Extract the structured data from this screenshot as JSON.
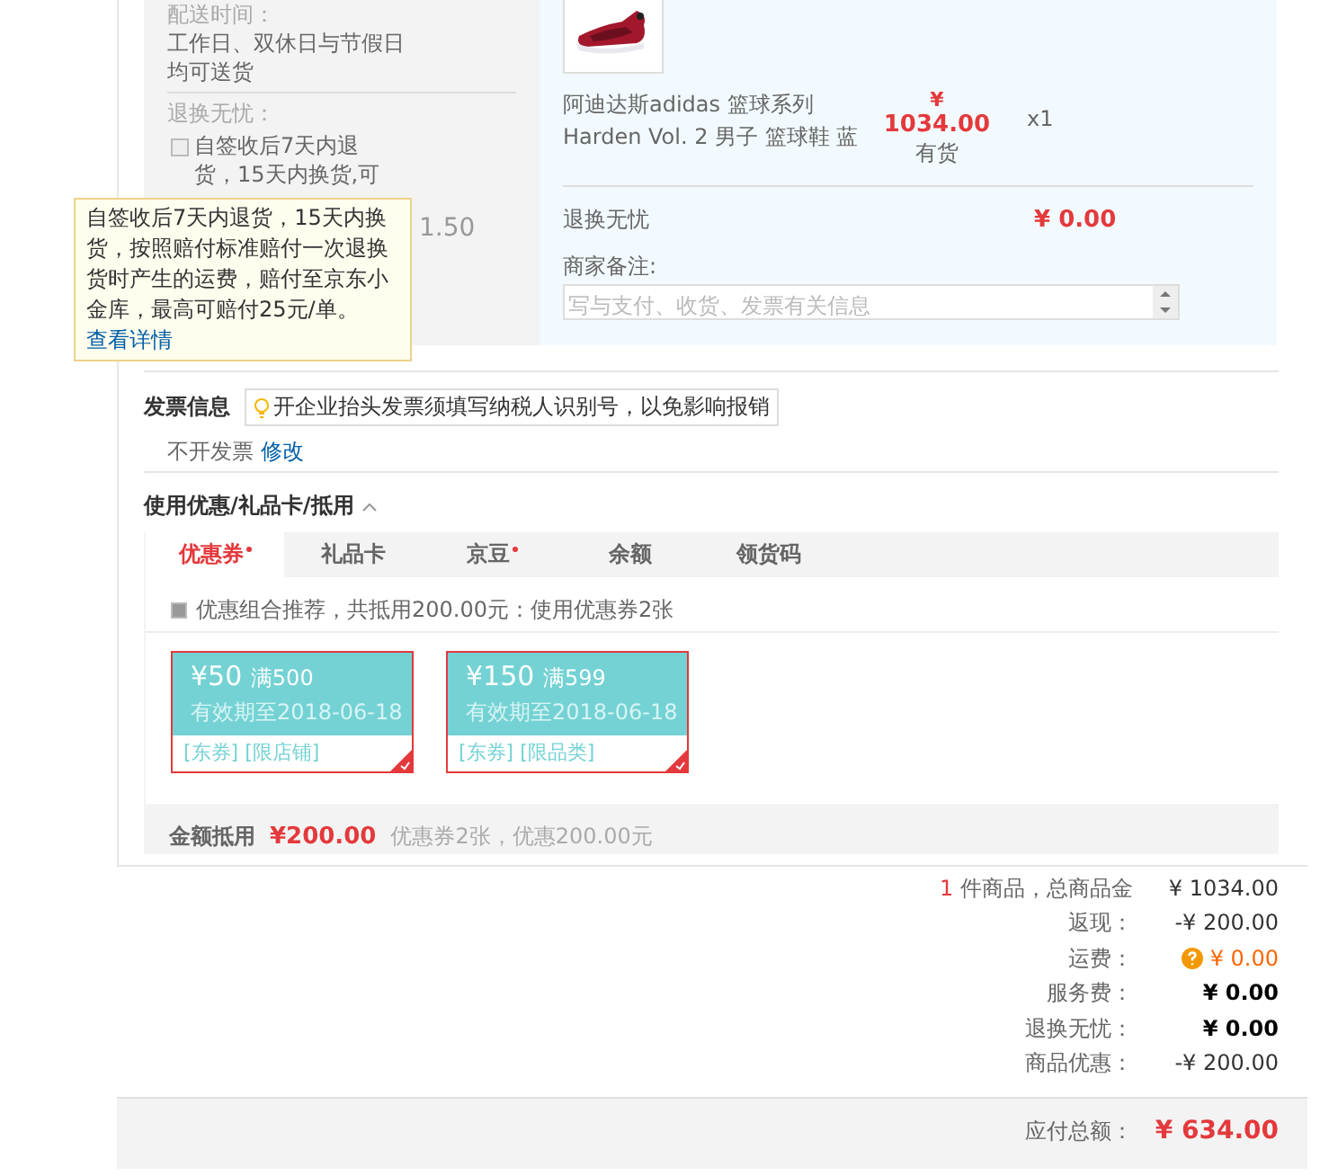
{
  "shipping": {
    "delivery_label": "配送时间：",
    "delivery_value": "工作日、双休日与节假日均可送货",
    "return_label": "退换无忧：",
    "return_option": {
      "text": "自签收后7天内退货，15天内换货,可",
      "checked": false
    },
    "return_price": "1.50",
    "tooltip": {
      "text": "自签收后7天内退货，15天内换货，按照赔付标准赔付一次退换货时产生的运费，赔付至京东小金库，最高可赔付25元/单。",
      "link": "查看详情"
    }
  },
  "product": {
    "name": "阿迪达斯adidas 篮球系列 Harden Vol. 2 男子 篮球鞋 蓝",
    "currency": "¥",
    "price": "1034.00",
    "stock": "有货",
    "quantity": "x1",
    "service_label": "退换无忧",
    "service_price": "¥ 0.00",
    "remark_label": "商家备注:",
    "remark_placeholder": "写与支付、收货、发票有关信息"
  },
  "invoice": {
    "title": "发票信息",
    "tip": "开企业抬头发票须填写纳税人识别号，以免影响报销",
    "value": "不开发票",
    "edit_link": "修改"
  },
  "discounts": {
    "title": "使用优惠/礼品卡/抵用",
    "expanded": true,
    "tabs": [
      {
        "label": "优惠券",
        "selected": true,
        "marked": true
      },
      {
        "label": "礼品卡",
        "selected": false,
        "marked": false
      },
      {
        "label": "京豆",
        "selected": false,
        "marked": true
      },
      {
        "label": "余额",
        "selected": false,
        "marked": false
      },
      {
        "label": "领货码",
        "selected": false,
        "marked": false
      }
    ],
    "recommend": {
      "text": "优惠组合推荐，共抵用200.00元：使用优惠券2张",
      "checked": true
    },
    "coupons": [
      {
        "amount": "¥50",
        "condition": "满500",
        "validity": "有效期至2018-06-18",
        "tags": "[东券] [限店铺]",
        "selected": true
      },
      {
        "amount": "¥150",
        "condition": "满599",
        "validity": "有效期至2018-06-18",
        "tags": "[东券] [限品类]",
        "selected": true
      }
    ],
    "total_label": "金额抵用",
    "total_value": "¥200.00",
    "total_note": "优惠券2张，优惠200.00元"
  },
  "summary": {
    "rows": [
      {
        "count": "1",
        "label": "件商品，总商品金",
        "value": "¥ 1034.00",
        "kind": "amount"
      },
      {
        "label": "返现：",
        "value": "-¥ 200.00",
        "kind": "amount"
      },
      {
        "label": "运费：",
        "value": "¥ 0.00",
        "kind": "fee"
      },
      {
        "label": "服务费：",
        "value": "¥ 0.00",
        "kind": "zero"
      },
      {
        "label": "退换无忧：",
        "value": "¥ 0.00",
        "kind": "zero"
      },
      {
        "label": "商品优惠：",
        "value": "-¥ 200.00",
        "kind": "amount"
      }
    ],
    "total_label": "应付总额：",
    "total_value": "¥ 634.00"
  }
}
